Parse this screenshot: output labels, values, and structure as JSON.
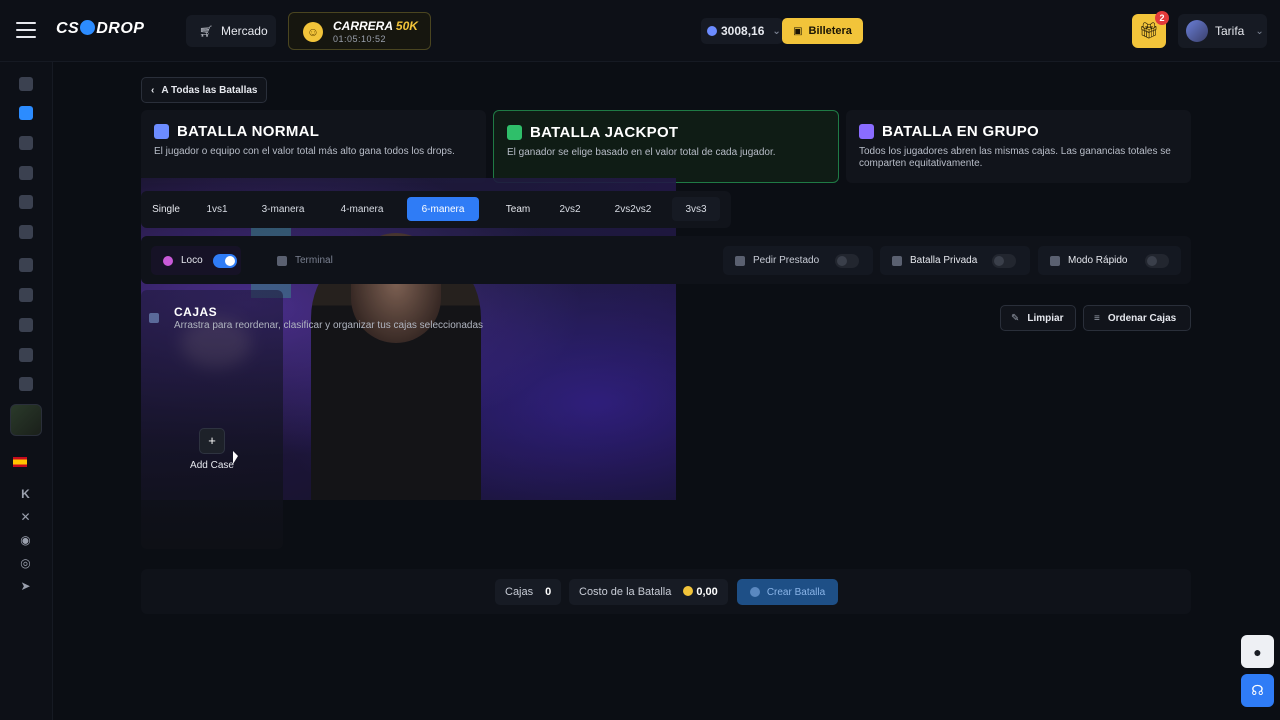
{
  "header": {
    "logo": "CS DROP",
    "market_label": "Mercado",
    "race_title": "CARRERA",
    "race_amount": "50K",
    "race_timer": "01:05:10:52",
    "balance": "3008,16",
    "wallet_label": "Billetera",
    "gift_count": "2",
    "profile_name": "Tarifa"
  },
  "back_label": "A Todas las Batallas",
  "modes": [
    {
      "title": "BATALLA NORMAL",
      "desc": "El jugador o equipo con el valor total más alto gana todos los drops.",
      "color": "#6c8cff"
    },
    {
      "title": "BATALLA JACKPOT",
      "desc": "El ganador se elige basado en el valor total de cada jugador.",
      "color": "#2fbf6a"
    },
    {
      "title": "BATALLA EN GRUPO",
      "desc": "Todos los jugadores abren las mismas cajas. Las ganancias totales se comparten equitativamente.",
      "color": "#8a6cff"
    }
  ],
  "ways": {
    "single_label": "Single",
    "single": [
      "1vs1",
      "3-manera",
      "4-manera",
      "6-manera"
    ],
    "team_label": "Team",
    "team": [
      "2vs2",
      "2vs2vs2",
      "3vs3"
    ],
    "selected": "6-manera"
  },
  "options": {
    "loco": "Loco",
    "terminal": "Terminal",
    "borrow": "Pedir Prestado",
    "private": "Batalla Privada",
    "fast": "Modo Rápido"
  },
  "cases": {
    "title": "CAJAS",
    "subtitle": "Arrastra para reordenar, clasificar y organizar tus cajas seleccionadas",
    "clear_label": "Limpiar",
    "sort_label": "Ordenar Cajas",
    "add_label": "Add Case"
  },
  "footer": {
    "cases_label": "Cajas",
    "cases_count": "0",
    "cost_label": "Costo de la Batalla",
    "cost_value": "0,00",
    "create_label": "Crear Batalla"
  },
  "colors": {
    "accent": "#2f7cf6",
    "gold": "#f2c43a",
    "jackpot_border": "#1f7a45"
  }
}
